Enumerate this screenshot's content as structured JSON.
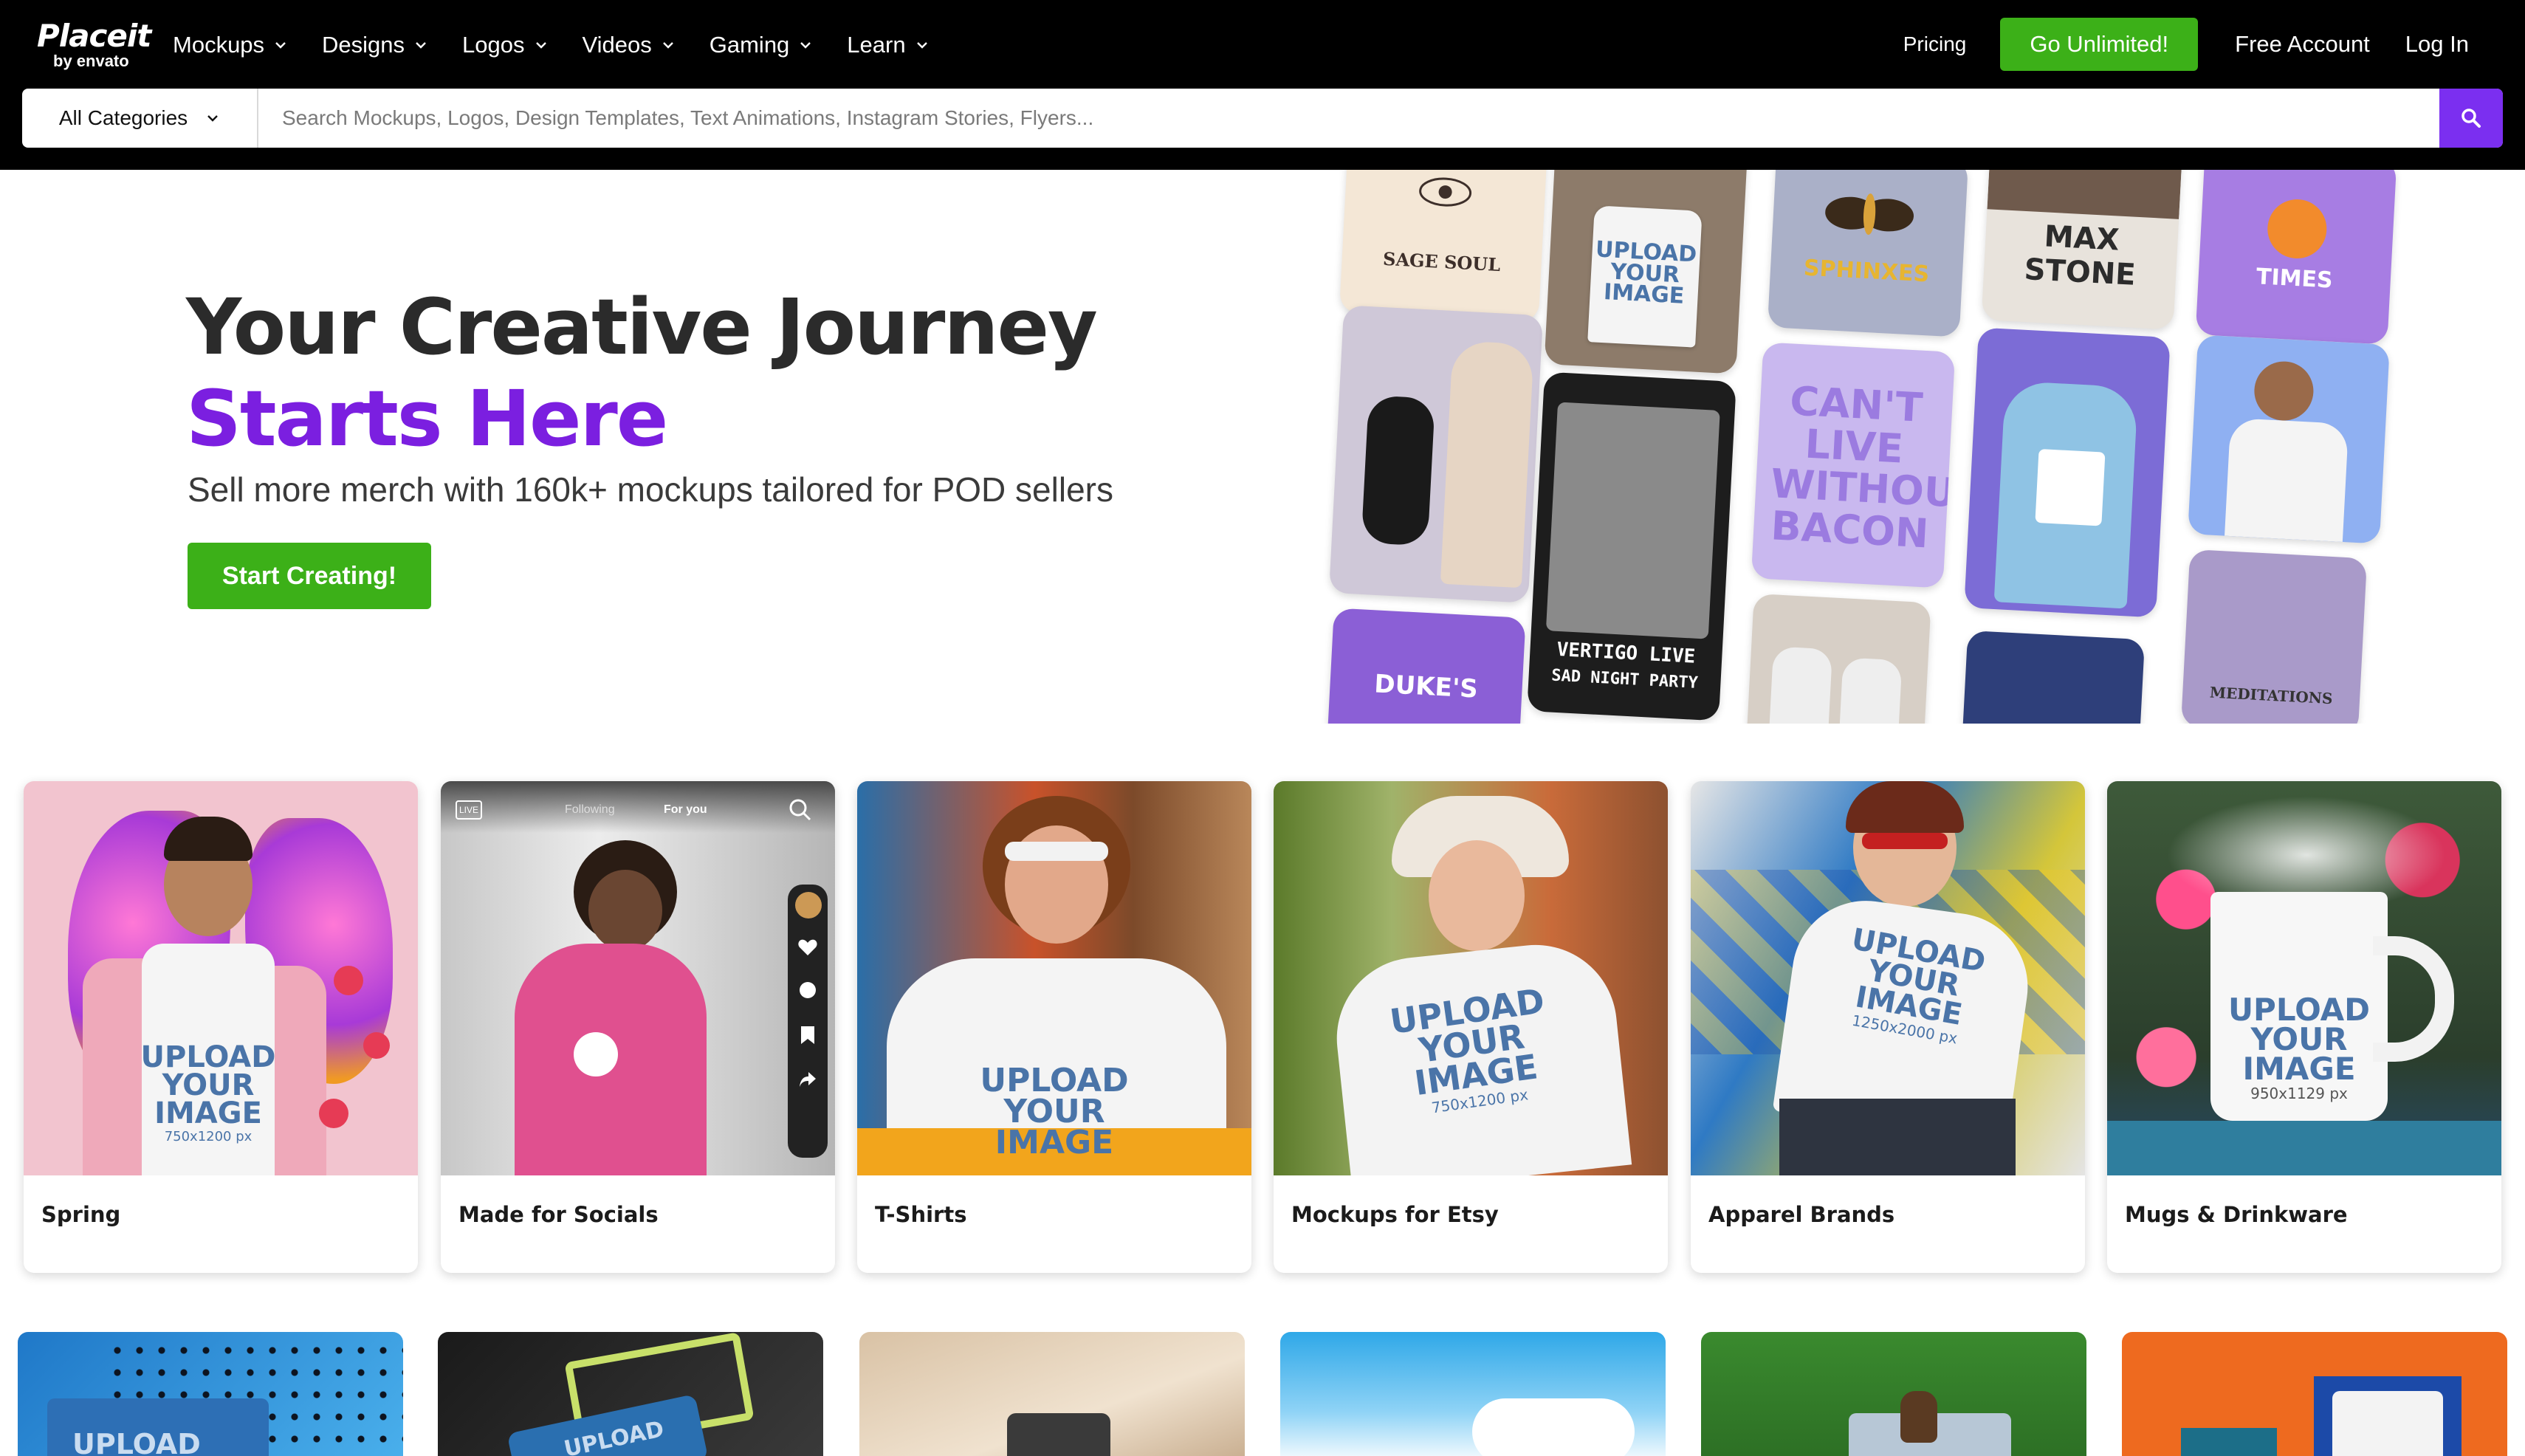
{
  "brand": {
    "name": "Placeit",
    "sub": "by envato"
  },
  "nav": {
    "items": [
      "Mockups",
      "Designs",
      "Logos",
      "Videos",
      "Gaming",
      "Learn"
    ],
    "pricing": "Pricing",
    "cta": "Go Unlimited!",
    "free_account": "Free Account",
    "login": "Log In"
  },
  "search": {
    "category": "All Categories",
    "placeholder": "Search Mockups, Logos, Design Templates, Text Animations, Instagram Stories, Flyers..."
  },
  "hero": {
    "title_line1": "Your Creative Journey",
    "title_line2": "Starts Here",
    "subtitle": "Sell more merch with 160k+ mockups tailored for POD sellers",
    "cta": "Start Creating!"
  },
  "collage": {
    "sage_soul": "SAGE SOUL",
    "sphinxes": "SPHINXES",
    "max_stone": "MAX STONE",
    "times": "TIMES",
    "cant_live": "CAN'T LIVE WITHOUT BACON",
    "vertigo": "VERTIGO LIVE",
    "sad_night": "SAD NIGHT PARTY",
    "dukes": "DUKE'S",
    "meditations": "MEDITATIONS",
    "upload_lines": [
      "UPLOAD",
      "YOUR",
      "IMAGE"
    ]
  },
  "categories": [
    {
      "label": "Spring"
    },
    {
      "label": "Made for Socials"
    },
    {
      "label": "T-Shirts"
    },
    {
      "label": "Mockups for Etsy"
    },
    {
      "label": "Apparel Brands"
    },
    {
      "label": "Mugs & Drinkware"
    }
  ],
  "card_text": {
    "upload": "UPLOAD",
    "your": "YOUR",
    "image": "IMAGE",
    "size_750": "750x1200 px",
    "size_1250": "1250x2000 px",
    "size_950": "950x1129 px",
    "following": "Following",
    "for_you": "For you",
    "live": "LIVE"
  },
  "colors": {
    "accent_green": "#3cb018",
    "accent_purple": "#7b2ff0",
    "headline_purple": "#7b1fe0"
  }
}
